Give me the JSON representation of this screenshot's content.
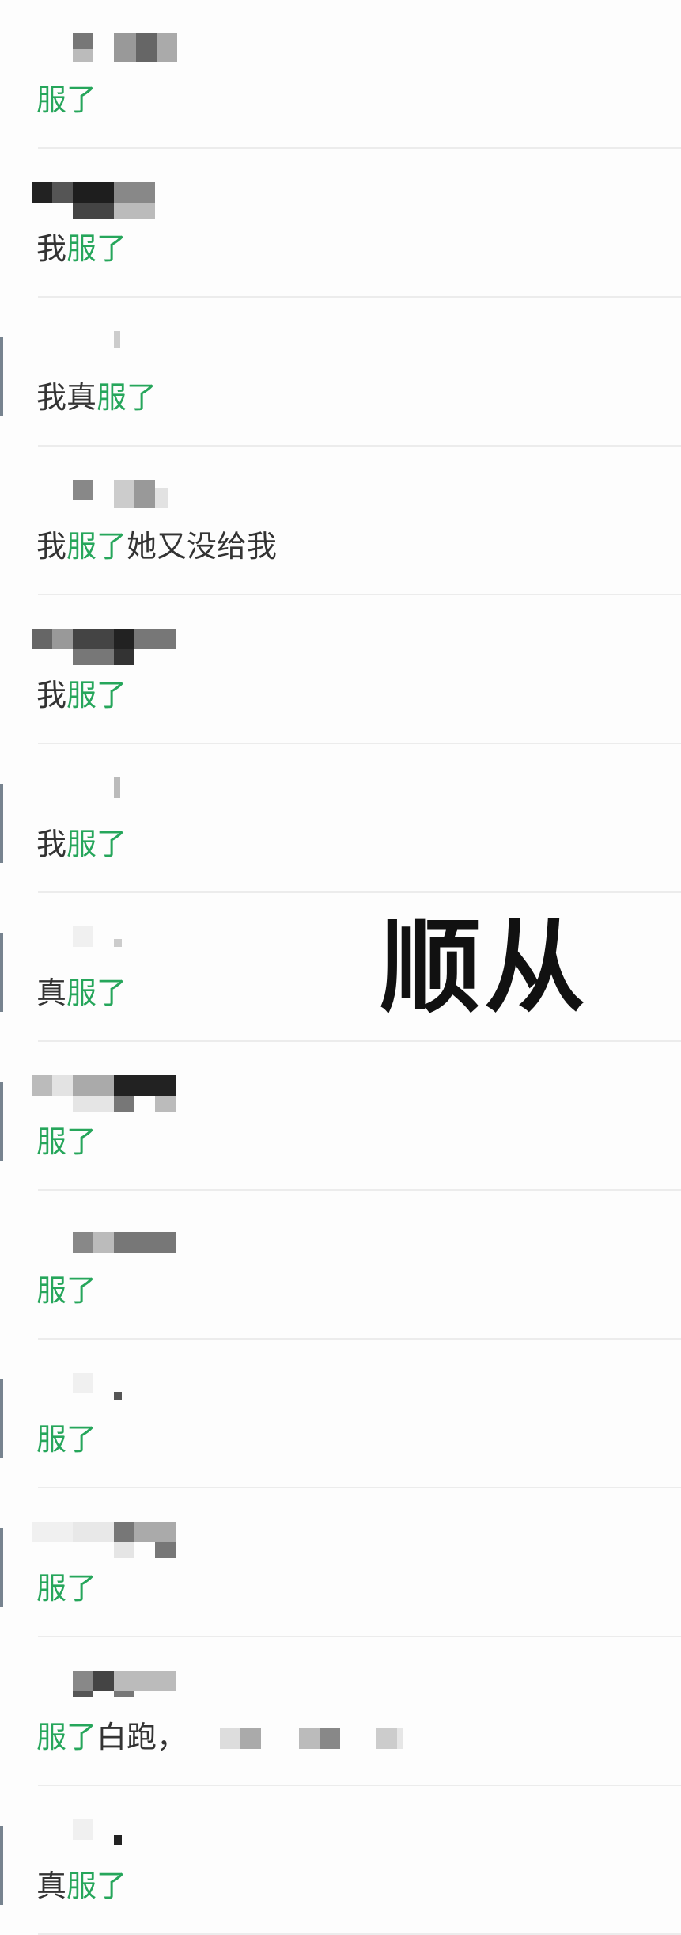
{
  "overlay_text": "顺从",
  "colors": {
    "highlight": "#26a65b",
    "text": "#333333",
    "divider": "#ececec"
  },
  "comments": [
    {
      "pre": "",
      "hl": "服了",
      "post": ""
    },
    {
      "pre": "我",
      "hl": "服了",
      "post": ""
    },
    {
      "pre": "我真",
      "hl": "服了",
      "post": ""
    },
    {
      "pre": "我",
      "hl": "服了",
      "post": "她又没给我"
    },
    {
      "pre": "我",
      "hl": "服了",
      "post": ""
    },
    {
      "pre": "我",
      "hl": "服了",
      "post": ""
    },
    {
      "pre": "真",
      "hl": "服了",
      "post": ""
    },
    {
      "pre": "",
      "hl": "服了",
      "post": ""
    },
    {
      "pre": "",
      "hl": "服了",
      "post": ""
    },
    {
      "pre": "",
      "hl": "服了",
      "post": ""
    },
    {
      "pre": "",
      "hl": "服了",
      "post": ""
    },
    {
      "pre": "",
      "hl": "服了",
      "post": "白跑，"
    },
    {
      "pre": "真",
      "hl": "服了",
      "post": ""
    }
  ]
}
